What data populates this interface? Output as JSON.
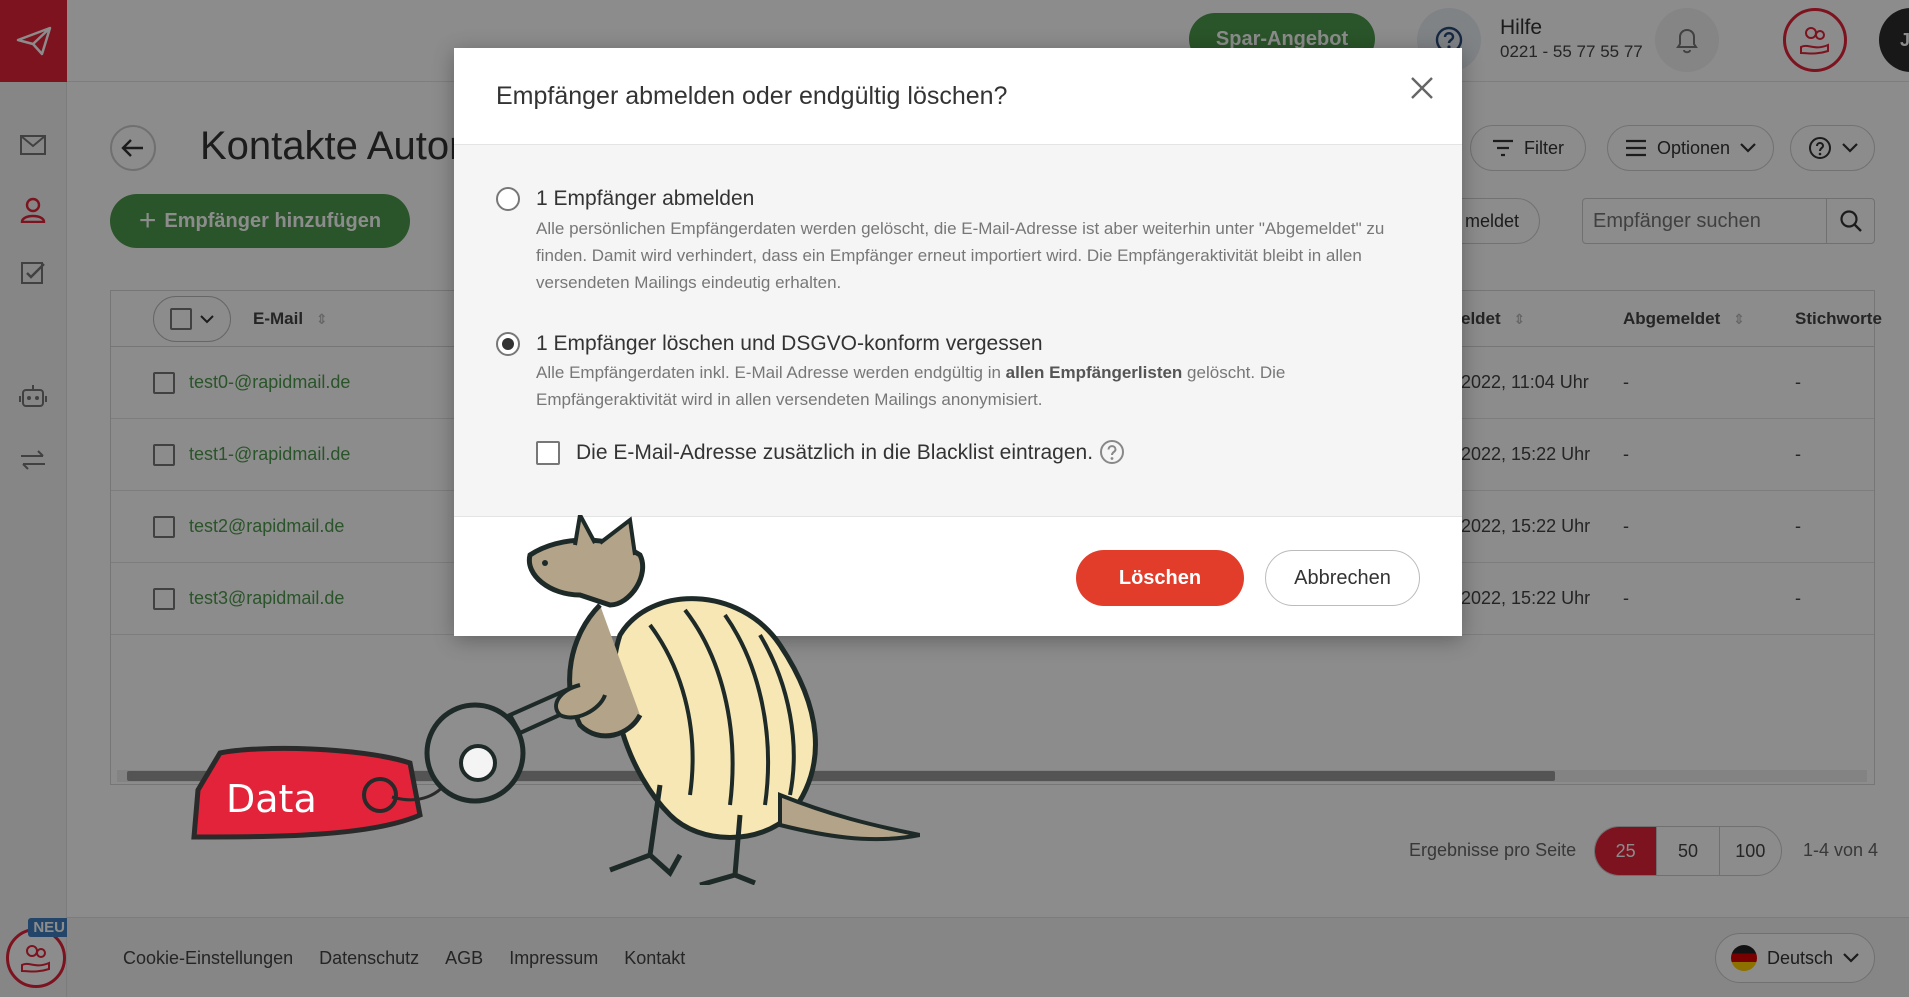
{
  "header": {
    "promo_label": "Spar-Angebot",
    "help_title": "Hilfe",
    "help_phone": "0221 - 55 77 55 77",
    "avatar_initials": "JE"
  },
  "sidebar": {
    "new_badge": "NEU",
    "items": [
      {
        "icon": "mail-icon"
      },
      {
        "icon": "contacts-icon"
      },
      {
        "icon": "checklist-icon"
      },
      {
        "icon": "robot-icon"
      },
      {
        "icon": "transfer-icon"
      }
    ]
  },
  "page": {
    "title": "Kontakte Autor",
    "add_button": "Empfänger hinzufügen",
    "filter_button": "Filter",
    "options_button": "Optionen",
    "status_button": "meldet",
    "search_placeholder": "Empfänger suchen"
  },
  "table": {
    "headers": {
      "email": "E-Mail",
      "created": "eldet",
      "unsubscribed": "Abgemeldet",
      "keywords": "Stichworte"
    },
    "rows": [
      {
        "email": "test0-@rapidmail.de",
        "date": "2022, 11:04 Uhr",
        "unsubscribed": "-",
        "keywords": "-"
      },
      {
        "email": "test1-@rapidmail.de",
        "date": "2022, 15:22 Uhr",
        "unsubscribed": "-",
        "keywords": "-"
      },
      {
        "email": "test2@rapidmail.de",
        "date": "2022, 15:22 Uhr",
        "unsubscribed": "-",
        "keywords": "-"
      },
      {
        "email": "test3@rapidmail.de",
        "date": "2022, 15:22 Uhr",
        "unsubscribed": "-",
        "keywords": "-"
      }
    ]
  },
  "pagination": {
    "per_page_label": "Ergebnisse pro Seite",
    "options": [
      "25",
      "50",
      "100"
    ],
    "selected": "25",
    "count_label": "1-4 von 4"
  },
  "footer": {
    "links": [
      "Cookie-Einstellungen",
      "Datenschutz",
      "AGB",
      "Impressum",
      "Kontakt"
    ],
    "language": "Deutsch"
  },
  "modal": {
    "title": "Empfänger abmelden oder endgültig löschen?",
    "option1_label": "1 Empfänger abmelden",
    "option1_desc": "Alle persönlichen Empfängerdaten werden gelöscht, die E-Mail-Adresse ist aber weiterhin unter \"Abgemeldet\" zu finden. Damit wird verhindert, dass ein Empfänger erneut importiert wird. Die Empfängeraktivität bleibt in allen versendeten Mailings eindeutig erhalten.",
    "option2_label": "1 Empfänger löschen und DSGVO-konform vergessen",
    "option2_desc_a": "Alle Empfängerdaten inkl. E-Mail Adresse werden endgültig in ",
    "option2_desc_bold": "allen Empfängerlisten",
    "option2_desc_b": " gelöscht. Die Empfängeraktivität wird in allen versendeten Mailings anonymisiert.",
    "blacklist_label": "Die E-Mail-Adresse zusätzlich in die Blacklist eintragen.",
    "selected_option": 2,
    "delete_button": "Löschen",
    "cancel_button": "Abbrechen"
  },
  "mascot": {
    "tag_text": "Data"
  },
  "colors": {
    "brand_red": "#e2233a",
    "green": "#4e9a4b",
    "delete_red": "#e23d2a"
  }
}
